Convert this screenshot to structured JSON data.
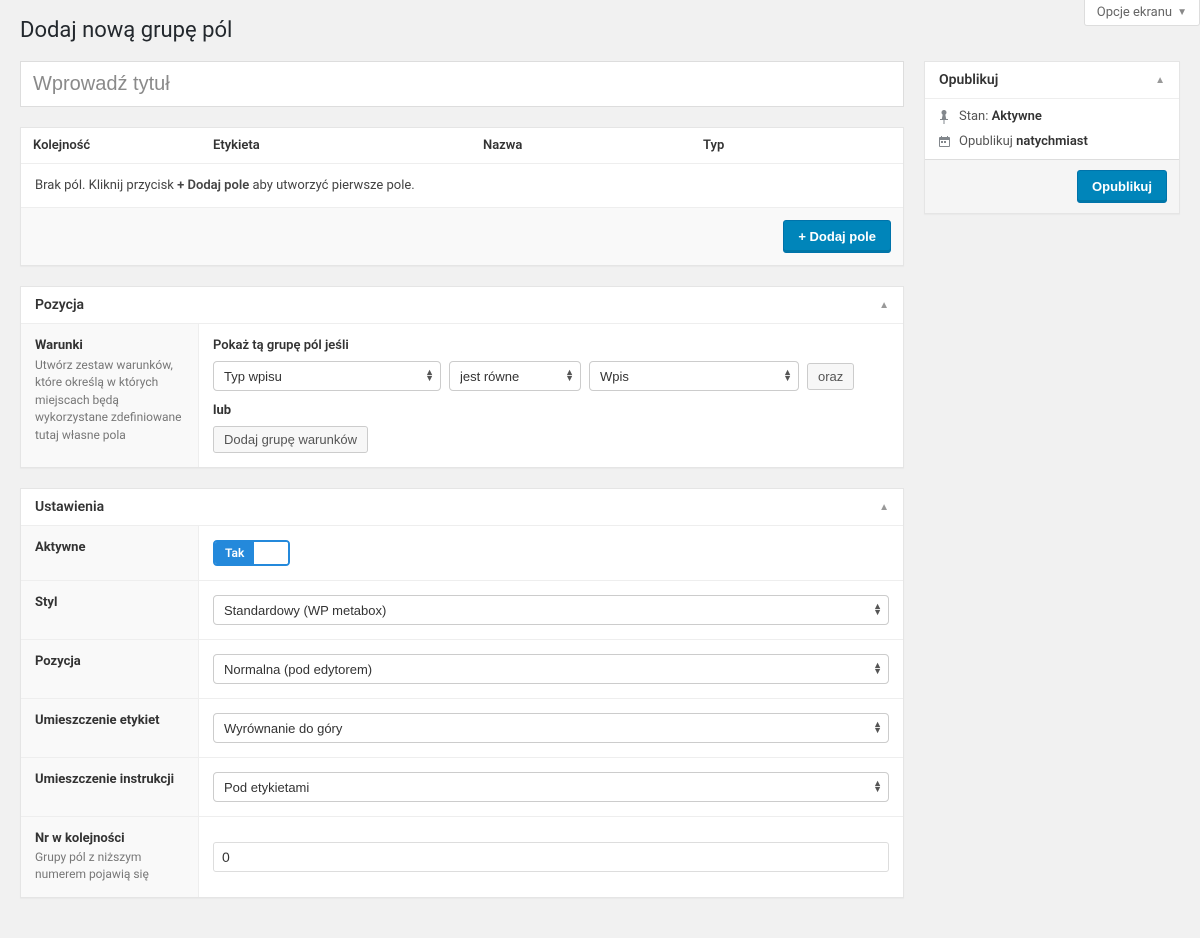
{
  "screen_options_label": "Opcje ekranu",
  "page_title": "Dodaj nową grupę pól",
  "title_placeholder": "Wprowadź tytuł",
  "fields": {
    "headers": {
      "order": "Kolejność",
      "label": "Etykieta",
      "name": "Nazwa",
      "type": "Typ"
    },
    "empty_pre": "Brak pól. Kliknij przycisk ",
    "empty_bold": "+ Dodaj pole",
    "empty_post": " aby utworzyć pierwsze pole.",
    "add_button": "+ Dodaj pole"
  },
  "location": {
    "panel_title": "Pozycja",
    "side_heading": "Warunki",
    "side_desc": "Utwórz zestaw warunków, które określą w których miejscach będą wykorzystane zdefiniowane tutaj własne pola",
    "show_label": "Pokaż tą grupę pól jeśli",
    "param": "Typ wpisu",
    "op": "jest równe",
    "value": "Wpis",
    "and_btn": "oraz",
    "or_label": "lub",
    "add_group_btn": "Dodaj grupę warunków"
  },
  "settings": {
    "panel_title": "Ustawienia",
    "active": {
      "label": "Aktywne",
      "value": "Tak"
    },
    "style": {
      "label": "Styl",
      "value": "Standardowy (WP metabox)"
    },
    "position": {
      "label": "Pozycja",
      "value": "Normalna (pod edytorem)"
    },
    "label_placement": {
      "label": "Umieszczenie etykiet",
      "value": "Wyrównanie do góry"
    },
    "instr_placement": {
      "label": "Umieszczenie instrukcji",
      "value": "Pod etykietami"
    },
    "order": {
      "label": "Nr w kolejności",
      "desc": "Grupy pól z niższym numerem pojawią się",
      "value": "0"
    }
  },
  "publish": {
    "panel_title": "Opublikuj",
    "status_label": "Stan: ",
    "status_value": "Aktywne",
    "publish_label": "Opublikuj ",
    "publish_value": "natychmiast",
    "button": "Opublikuj"
  }
}
